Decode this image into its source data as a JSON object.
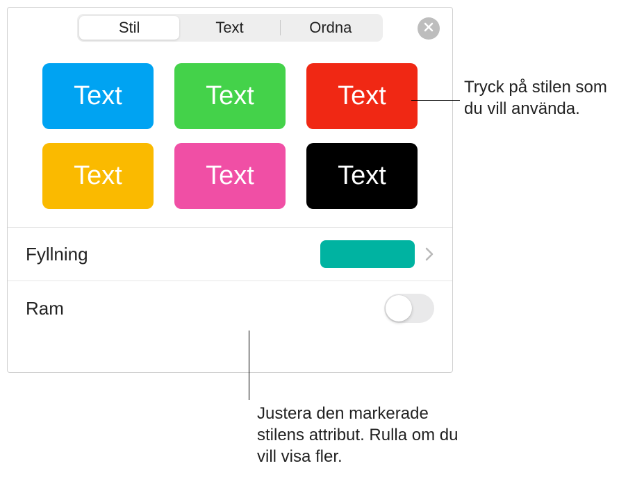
{
  "tabs": {
    "stil": "Stil",
    "text": "Text",
    "ordna": "Ordna"
  },
  "swatches": [
    {
      "label": "Text",
      "color": "#00A3F2"
    },
    {
      "label": "Text",
      "color": "#44D24A"
    },
    {
      "label": "Text",
      "color": "#F02814"
    },
    {
      "label": "Text",
      "color": "#FABA00"
    },
    {
      "label": "Text",
      "color": "#F04FA5"
    },
    {
      "label": "Text",
      "color": "#000000"
    }
  ],
  "rows": {
    "fill_label": "Fyllning",
    "fill_color": "#00B3A1",
    "border_label": "Ram",
    "border_on": false
  },
  "callouts": {
    "c1": "Tryck på stilen som du vill använda.",
    "c2": "Justera den markerade stilens attribut. Rulla om du vill visa fler."
  }
}
